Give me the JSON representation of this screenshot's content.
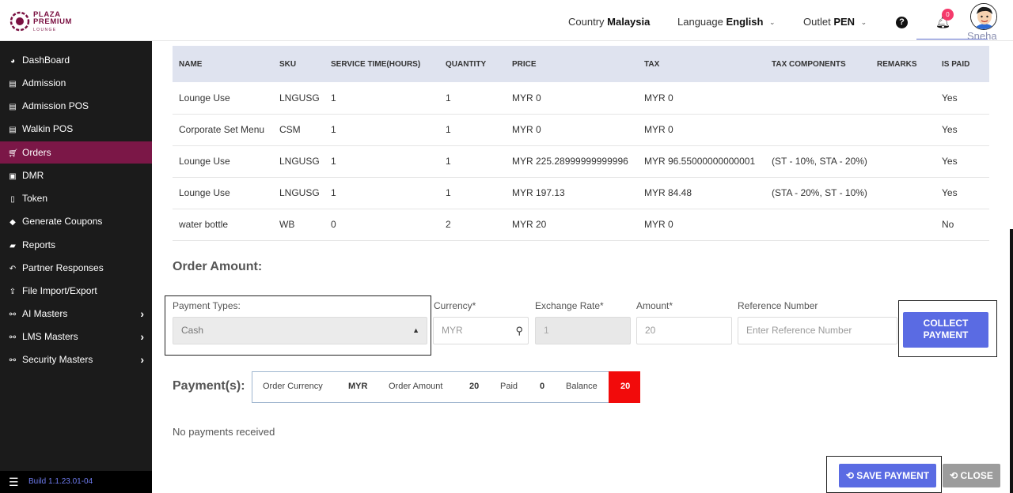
{
  "brand": {
    "line1": "PLAZA",
    "line2": "PREMIUM",
    "line3": "LOUNGE",
    "color": "#7a1041"
  },
  "header": {
    "country_label": "Country",
    "country_value": "Malaysia",
    "language_label": "Language",
    "language_value": "English",
    "outlet_label": "Outlet",
    "outlet_value": "PEN",
    "help_icon": "question-circle-icon",
    "notification_count": "0",
    "user_name": "Sneha"
  },
  "sidebar": {
    "active_color": "#7b1747",
    "items": [
      {
        "label": "DashBoard",
        "icon": "dashboard-icon",
        "glyph": "◕"
      },
      {
        "label": "Admission",
        "icon": "id-card-icon",
        "glyph": "▤"
      },
      {
        "label": "Admission POS",
        "icon": "id-card-icon",
        "glyph": "▤"
      },
      {
        "label": "Walkin POS",
        "icon": "id-card-icon",
        "glyph": "▤"
      },
      {
        "label": "Orders",
        "icon": "cart-icon",
        "glyph": "🛒"
      },
      {
        "label": "DMR",
        "icon": "calendar-icon",
        "glyph": "▣"
      },
      {
        "label": "Token",
        "icon": "file-icon",
        "glyph": "▯"
      },
      {
        "label": "Generate Coupons",
        "icon": "tag-icon",
        "glyph": "◆"
      },
      {
        "label": "Reports",
        "icon": "book-icon",
        "glyph": "▰"
      },
      {
        "label": "Partner Responses",
        "icon": "reply-icon",
        "glyph": "↶"
      },
      {
        "label": "File Import/Export",
        "icon": "upload-icon",
        "glyph": "⇪"
      },
      {
        "label": "AI Masters",
        "icon": "sitemap-icon",
        "glyph": "⚯",
        "expand": "›"
      },
      {
        "label": "LMS Masters",
        "icon": "sitemap-icon",
        "glyph": "⚯",
        "expand": "›"
      },
      {
        "label": "Security Masters",
        "icon": "sitemap-icon",
        "glyph": "⚯",
        "expand": "›"
      }
    ],
    "build": "Build 1.1.23.01-04"
  },
  "table": {
    "headers": [
      "NAME",
      "SKU",
      "SERVICE TIME(HOURS)",
      "QUANTITY",
      "PRICE",
      "TAX",
      "TAX COMPONENTS",
      "REMARKS",
      "IS PAID"
    ],
    "rows": [
      [
        "Lounge Use",
        "LNGUSG",
        "1",
        "1",
        "MYR 0",
        "MYR 0",
        "",
        "",
        "Yes"
      ],
      [
        "Corporate Set Menu",
        "CSM",
        "1",
        "1",
        "MYR 0",
        "MYR 0",
        "",
        "",
        "Yes"
      ],
      [
        "Lounge Use",
        "LNGUSG",
        "1",
        "1",
        "MYR 225.28999999999996",
        "MYR 96.55000000000001",
        "(ST - 10%, STA - 20%)",
        "",
        "Yes"
      ],
      [
        "Lounge Use",
        "LNGUSG",
        "1",
        "1",
        "MYR 197.13",
        "MYR 84.48",
        "(STA - 20%, ST - 10%)",
        "",
        "Yes"
      ],
      [
        "water bottle",
        "WB",
        "0",
        "2",
        "MYR 20",
        "MYR 0",
        "",
        "",
        "No"
      ]
    ]
  },
  "order_amount_title": "Order Amount:",
  "form": {
    "payment_types_label": "Payment Types:",
    "payment_type_value": "Cash",
    "currency_label": "Currency*",
    "currency_value": "MYR",
    "exchange_rate_label": "Exchange Rate*",
    "exchange_rate_value": "1",
    "amount_label": "Amount*",
    "amount_value": "20",
    "reference_label": "Reference Number",
    "reference_placeholder": "Enter Reference Number",
    "collect_line1": "COLLECT",
    "collect_line2": "PAYMENT"
  },
  "payments": {
    "title": "Payment(s):",
    "order_currency_label": "Order Currency",
    "order_currency_value": "MYR",
    "order_amount_label": "Order Amount",
    "order_amount_value": "20",
    "paid_label": "Paid",
    "paid_value": "0",
    "balance_label": "Balance",
    "balance_value": "20",
    "balance_color": "#f20b0b",
    "empty_text": "No payments received"
  },
  "actions": {
    "save_label": "SAVE PAYMENT",
    "close_label": "CLOSE",
    "primary_color": "#5a6be3"
  }
}
